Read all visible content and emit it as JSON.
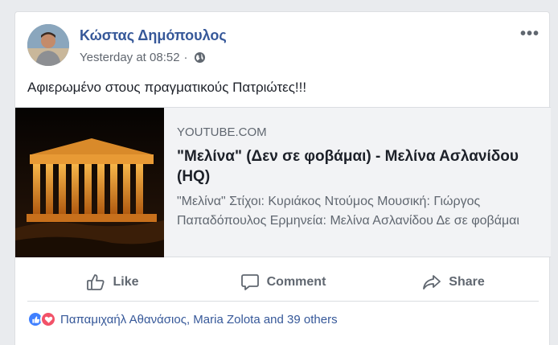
{
  "post": {
    "author": "Κώστας Δημόπουλος",
    "timestamp": "Yesterday at 08:52",
    "separator": "·",
    "privacy_icon": "globe-icon",
    "more_icon": "•••",
    "text": "Αφιερωμένο στους πραγματικούς Πατριώτες!!!"
  },
  "link_preview": {
    "domain": "YOUTUBE.COM",
    "title": "\"Μελίνα\" (Δεν σε φοβάμαι) - Μελίνα Ασλανίδου (HQ)",
    "description": "\"Μελίνα\" Στίχοι: Κυριάκος Ντούμος Μουσική: Γιώργος Παπαδόπουλος Ερμηνεία: Μελίνα Ασλανίδου Δε σε φοβάμαι"
  },
  "actions": {
    "like": "Like",
    "comment": "Comment",
    "share": "Share"
  },
  "reactions": {
    "summary": "Παπαμιχαήλ Αθανάσιος, Maria Zolota and 39 others",
    "colors": {
      "like": "#4080ff",
      "love": "#f25268"
    }
  }
}
